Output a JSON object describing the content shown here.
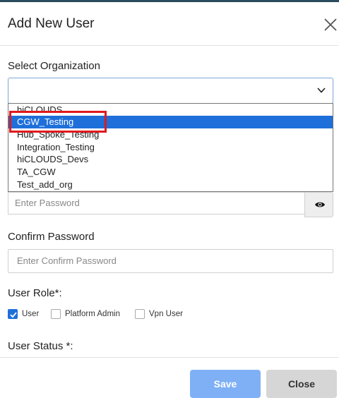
{
  "modal": {
    "title": "Add New User",
    "close_icon": "close-icon"
  },
  "organization": {
    "label": "Select Organization",
    "selected_value": "",
    "options": [
      "hiCLOUDS",
      "CGW_Testing",
      "Hub_Spoke_Testing",
      "Integration_Testing",
      "hiCLOUDS_Devs",
      "TA_CGW",
      "Test_add_org"
    ],
    "highlighted_option": "CGW_Testing"
  },
  "password": {
    "placeholder": "Enter Password",
    "toggle_icon": "eye-icon"
  },
  "confirm_password": {
    "label": "Confirm Password",
    "placeholder": "Enter Confirm Password"
  },
  "user_role": {
    "label": "User Role*:",
    "options": [
      {
        "label": "User",
        "checked": true
      },
      {
        "label": "Platform Admin",
        "checked": false
      },
      {
        "label": "Vpn User",
        "checked": false
      }
    ]
  },
  "user_status": {
    "label": "User Status *:"
  },
  "footer": {
    "save_label": "Save",
    "close_label": "Close"
  },
  "colors": {
    "accent": "#1e6fd9",
    "save_button": "#7fb0f5",
    "close_button": "#d6d6d6",
    "highlight_outline": "#e0191e"
  }
}
